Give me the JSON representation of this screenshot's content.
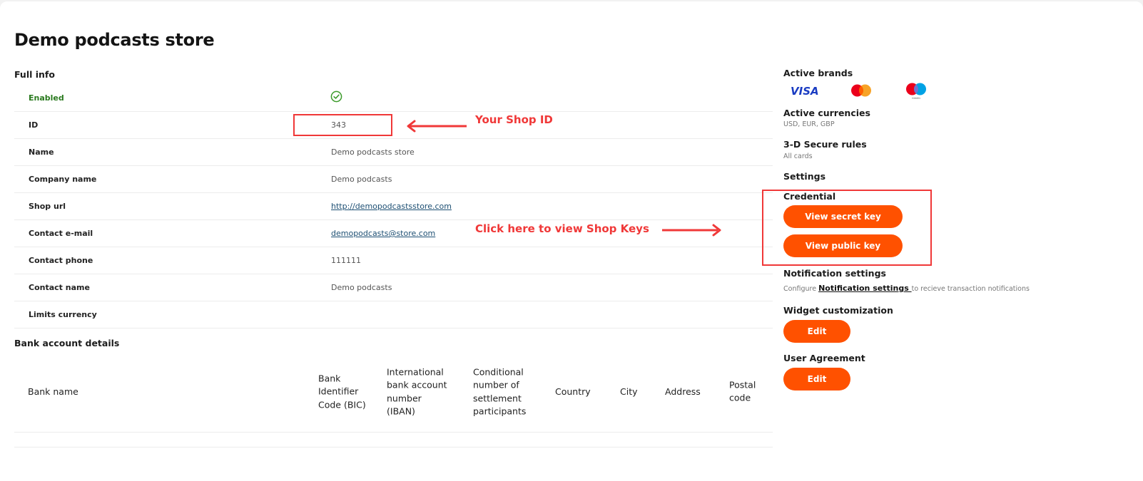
{
  "page": {
    "title": "Demo podcasts store"
  },
  "full_info": {
    "section_title": "Full info",
    "status_label": "Enabled",
    "status_icon": "check-circle-icon",
    "rows": [
      {
        "label": "ID",
        "value": "343"
      },
      {
        "label": "Name",
        "value": "Demo podcasts store"
      },
      {
        "label": "Company name",
        "value": "Demo podcasts"
      },
      {
        "label": "Shop url",
        "value": "http://demopodcastsstore.com",
        "link": true
      },
      {
        "label": "Contact e-mail",
        "value": "demopodcasts@store.com",
        "link": true
      },
      {
        "label": "Contact phone",
        "value": "111111"
      },
      {
        "label": "Contact name",
        "value": "Demo podcasts"
      },
      {
        "label": "Limits currency",
        "value": ""
      }
    ]
  },
  "bank": {
    "section_title": "Bank account details",
    "columns": [
      "Bank name",
      "Bank Identifier Code (BIC)",
      "International bank account number (IBAN)",
      "Conditional number of settlement participants",
      "Country",
      "City",
      "Address",
      "Postal code"
    ],
    "rows": []
  },
  "sidebar": {
    "active_brands_title": "Active brands",
    "brands": [
      {
        "name": "VISA",
        "icon": "visa-icon",
        "color": "#1a3cc2"
      },
      {
        "name": "Mastercard",
        "icon": "mastercard-icon",
        "colors": [
          "#eb001b",
          "#f79e1b"
        ]
      },
      {
        "name": "Maestro",
        "icon": "maestro-icon",
        "colors": [
          "#eb001b",
          "#00a2e5"
        ],
        "caption": "maestro"
      }
    ],
    "currencies_title": "Active currencies",
    "currencies_value": "USD, EUR, GBP",
    "secure_title": "3-D Secure rules",
    "secure_value": "All cards",
    "settings_title": "Settings",
    "credential_title": "Credential",
    "view_secret_label": "View secret key",
    "view_public_label": "View public key",
    "notification_title": "Notification settings",
    "notification_prefix": "Configure ",
    "notification_link": "Notification settings ",
    "notification_suffix": "to recieve transaction notifications",
    "widget_title": "Widget customization",
    "widget_edit_label": "Edit",
    "agreement_title": "User Agreement",
    "agreement_edit_label": "Edit",
    "accent_color": "#ff5100"
  },
  "annotations": {
    "shop_id_text": "Your Shop ID",
    "keys_text": "Click here to view Shop Keys",
    "color": "#f03838"
  }
}
